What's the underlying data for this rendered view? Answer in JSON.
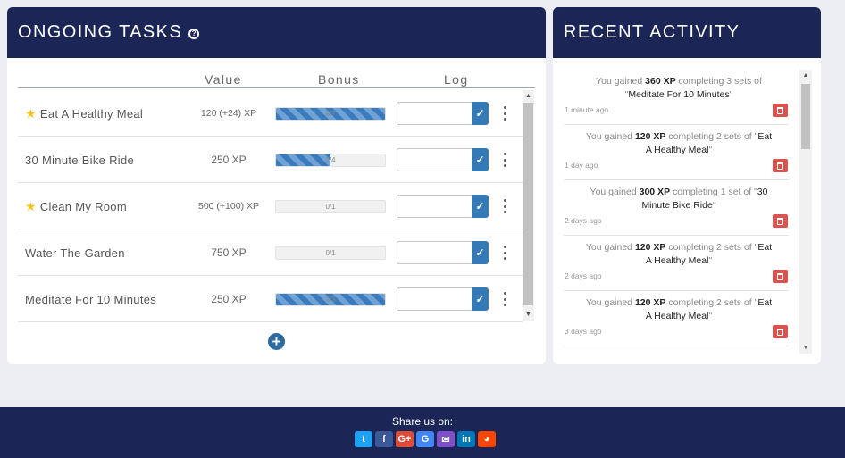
{
  "tasks": {
    "title": "ONGOING TASKS",
    "help_icon": "?",
    "headers": {
      "value": "Value",
      "bonus": "Bonus",
      "log": "Log"
    },
    "rows": [
      {
        "name": "Eat A Healthy Meal",
        "starred": true,
        "value": "120 (+24) XP",
        "bonus": "8/7",
        "bonus_fraction": 1.0
      },
      {
        "name": "30 Minute Bike Ride",
        "starred": false,
        "value": "250 XP",
        "bonus": "2/4",
        "bonus_fraction": 0.5
      },
      {
        "name": "Clean My Room",
        "starred": true,
        "value": "500 (+100) XP",
        "bonus": "0/1",
        "bonus_fraction": 0.0
      },
      {
        "name": "Water The Garden",
        "starred": false,
        "value": "750 XP",
        "bonus": "0/1",
        "bonus_fraction": 0.0
      },
      {
        "name": "Meditate For 10 Minutes",
        "starred": false,
        "value": "250 XP",
        "bonus": "3/3",
        "bonus_fraction": 1.0
      }
    ],
    "add_icon": "+"
  },
  "activity": {
    "title": "RECENT ACTIVITY",
    "items": [
      {
        "pre": "You gained ",
        "xp": "360 XP",
        "mid": " completing 3 sets of \"",
        "task": "Meditate For 10 Minutes",
        "post": "\"",
        "time": "1 minute ago"
      },
      {
        "pre": "You gained ",
        "xp": "120 XP",
        "mid": " completing 2 sets of \"",
        "task": "Eat A Healthy Meal",
        "post": "\"",
        "time": "1 day ago"
      },
      {
        "pre": "You gained ",
        "xp": "300 XP",
        "mid": " completing 1 set of \"",
        "task": "30 Minute Bike Ride",
        "post": "\"",
        "time": "2 days ago"
      },
      {
        "pre": "You gained ",
        "xp": "120 XP",
        "mid": " completing 2 sets of \"",
        "task": "Eat A Healthy Meal",
        "post": "\"",
        "time": "2 days ago"
      },
      {
        "pre": "You gained ",
        "xp": "120 XP",
        "mid": " completing 2 sets of \"",
        "task": "Eat A Healthy Meal",
        "post": "\"",
        "time": "3 days ago"
      }
    ]
  },
  "footer": {
    "share_label": "Share us on:",
    "share_icons": [
      {
        "name": "twitter-icon",
        "glyph": "t",
        "color": "#1da1f2"
      },
      {
        "name": "facebook-icon",
        "glyph": "f",
        "color": "#3b5998"
      },
      {
        "name": "google-plus-icon",
        "glyph": "G+",
        "color": "#dd4b39"
      },
      {
        "name": "google-icon",
        "glyph": "G",
        "color": "#4285f4"
      },
      {
        "name": "email-icon",
        "glyph": "✉",
        "color": "#7d4fc9"
      },
      {
        "name": "linkedin-icon",
        "glyph": "in",
        "color": "#0077b5"
      },
      {
        "name": "reddit-icon",
        "glyph": "◕",
        "color": "#ff4500"
      }
    ]
  },
  "colors": {
    "header_bg": "#1b2656",
    "accent": "#337ab7",
    "star": "#f1c21b",
    "delete": "#d9534f"
  }
}
